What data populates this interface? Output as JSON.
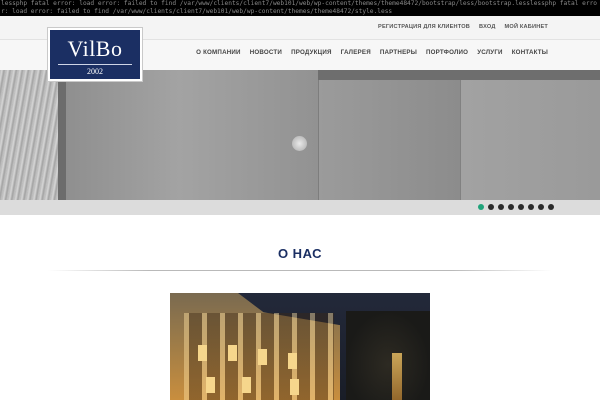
{
  "error_text": "lessphp fatal error: load error: failed to find /var/www/clients/client7/web101/web/wp-content/themes/theme48472/bootstrap/less/bootstrap.lesslessphp fatal error: load error: failed to find /var/www/clients/client7/web101/web/wp-content/themes/theme48472/style.less",
  "top_links": [
    "РЕГИСТРАЦИЯ ДЛЯ КЛИЕНТОВ",
    "ВХОД",
    "МОЙ КАБИНЕТ"
  ],
  "logo": {
    "name": "VilBo",
    "year": "2002"
  },
  "nav": [
    "О КОМПАНИИ",
    "НОВОСТИ",
    "ПРОДУКЦИЯ",
    "ГАЛЕРЕЯ",
    "ПАРТНЕРЫ",
    "ПОРТФОЛИО",
    "УСЛУГИ",
    "КОНТАКТЫ"
  ],
  "slider": {
    "active_index": 0,
    "slide_count": 8,
    "active_color": "#1fa37a"
  },
  "about": {
    "title": "О НАС"
  },
  "colors": {
    "brand": "#1b2f63",
    "accent": "#1fa37a"
  }
}
